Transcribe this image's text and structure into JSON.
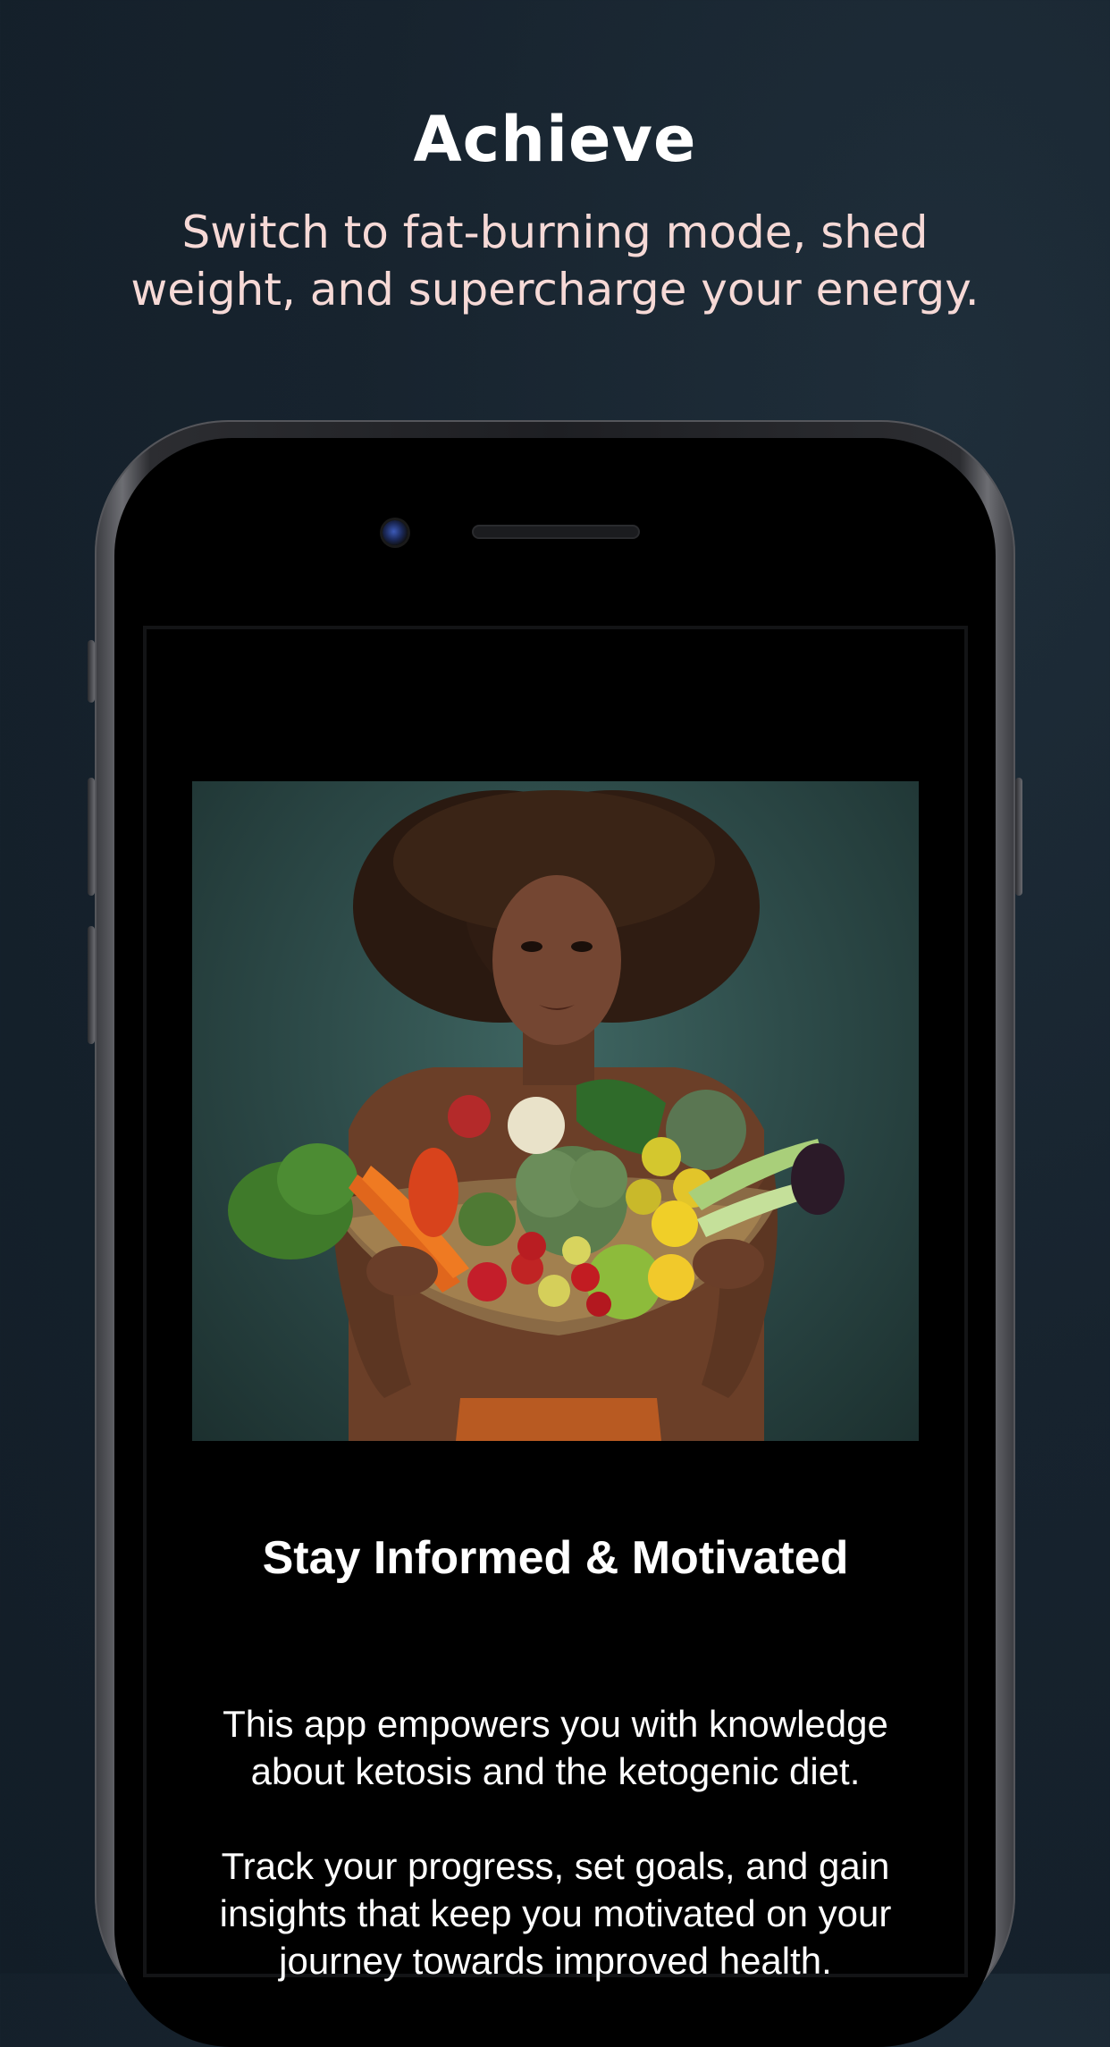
{
  "header": {
    "title": "Achieve",
    "subtitle": "Switch to fat-burning mode, shed weight, and supercharge your energy."
  },
  "screen": {
    "image_icon": "woman-holding-vegetable-basket-photo",
    "title": "Stay Informed & Motivated",
    "paragraphs": [
      "This app empowers you with knowledge about ketosis and the ketogenic diet.",
      "Track your progress, set goals, and gain insights that keep you motivated on your journey towards improved health."
    ]
  },
  "colors": {
    "background": "#17232e",
    "subtitle": "#f6d9d6",
    "screen_background": "#000000",
    "photo_background": "#3f6662"
  }
}
